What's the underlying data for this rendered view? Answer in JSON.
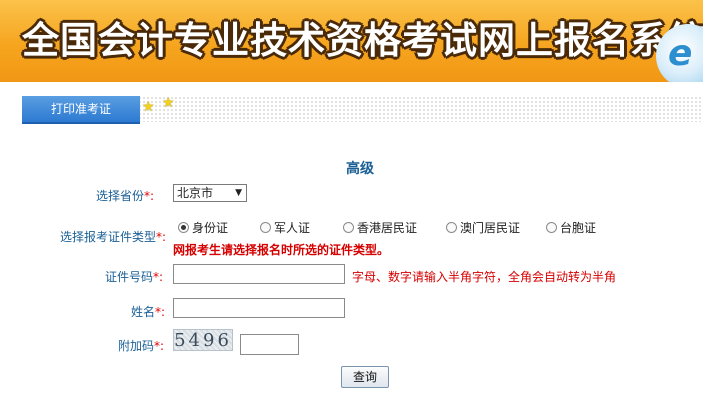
{
  "banner": {
    "title": "全国会计专业技术资格考试网上报名系统",
    "logo_letter": "e"
  },
  "tabs": [
    {
      "label": "打印准考证"
    }
  ],
  "form": {
    "section_title": "高级",
    "province": {
      "label": "选择省份",
      "required_mark": "*:",
      "selected": "北京市"
    },
    "id_type": {
      "label": "选择报考证件类型",
      "required_mark": "*:",
      "options": [
        "身份证",
        "军人证",
        "香港居民证",
        "澳门居民证",
        "台胞证"
      ],
      "selected_index": 0,
      "warning": "网报考生请选择报名时所选的证件类型。"
    },
    "id_number": {
      "label": "证件号码",
      "required_mark": "*:",
      "value": "",
      "hint": "字母、数字请输入半角字符，全角会自动转为半角"
    },
    "name": {
      "label": "姓名",
      "required_mark": "*:",
      "value": ""
    },
    "captcha": {
      "label": "附加码",
      "required_mark": "*:",
      "code": "5496",
      "value": ""
    },
    "submit_label": "查询"
  },
  "colors": {
    "label": "#1a5f95",
    "required": "#e00000",
    "tab": "#2d7ad2",
    "banner": "#f6a51f"
  }
}
